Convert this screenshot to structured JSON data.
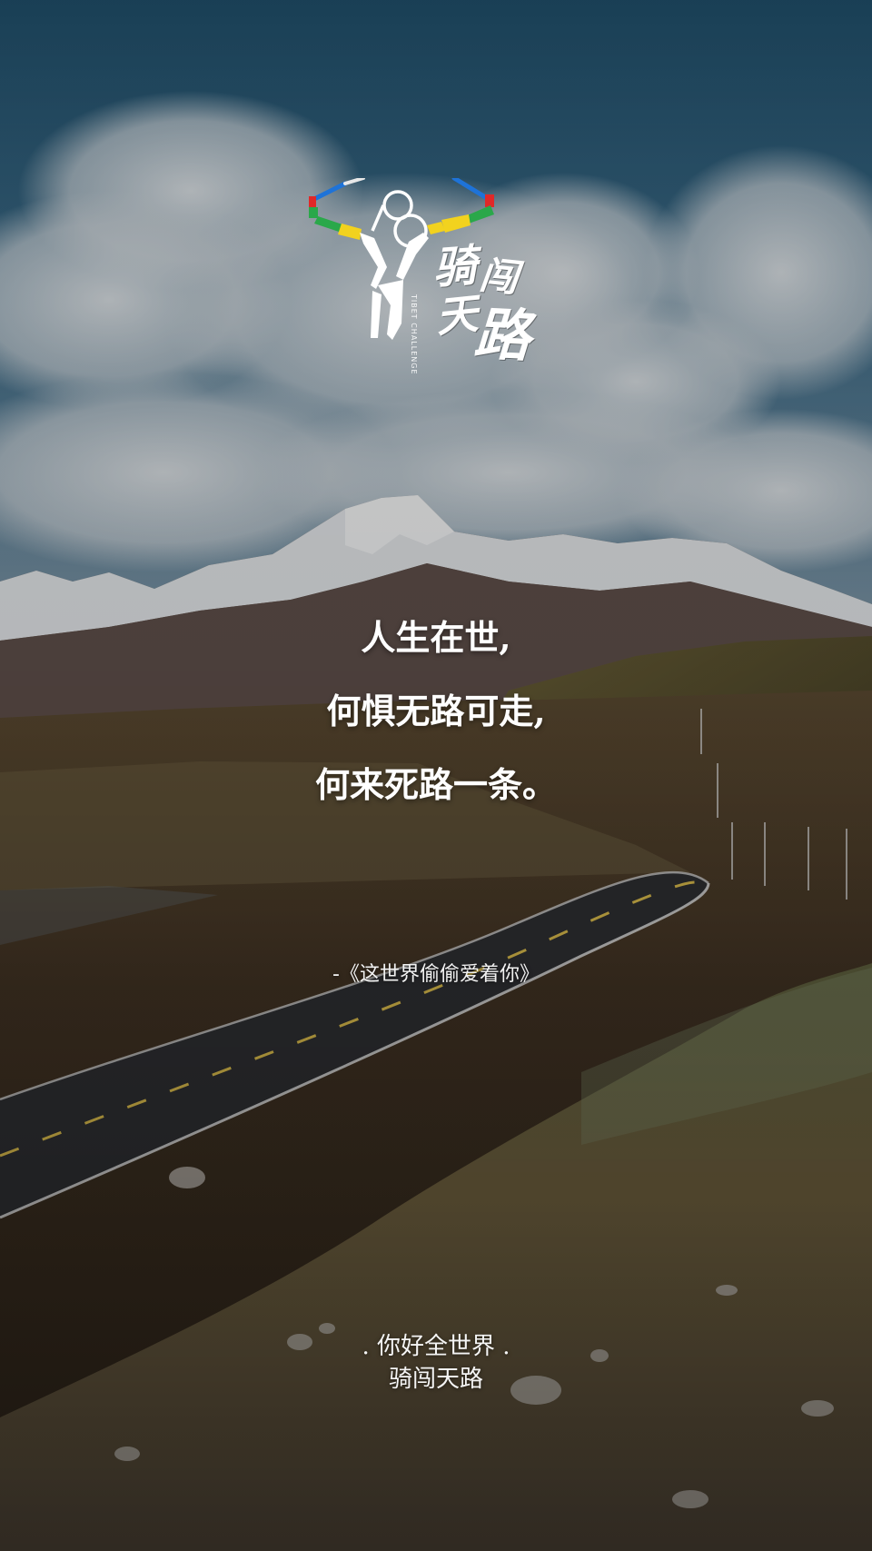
{
  "logo": {
    "chars": [
      "骑",
      "闯",
      "天",
      "路"
    ],
    "subtitle": "TIBET CHALLENGE",
    "prayer_flag_colors": [
      "#1e73d8",
      "#e8e8e8",
      "#e02828",
      "#2aa84a",
      "#f2d21e"
    ]
  },
  "quote": {
    "lines": [
      "人生在世,",
      "何惧无路可走,",
      "何来死路一条。"
    ]
  },
  "attribution": "-《这世界偷偷爱着你》",
  "footer": {
    "line1": ". 你好全世界 .",
    "line2": "骑闯天路"
  },
  "colors": {
    "sky": "#224d68",
    "snow": "#e6e9ec",
    "grass": "#6b5a32",
    "road": "#2f3034",
    "text": "#ffffff"
  },
  "icons": [
    "cyclist-logo-icon"
  ]
}
